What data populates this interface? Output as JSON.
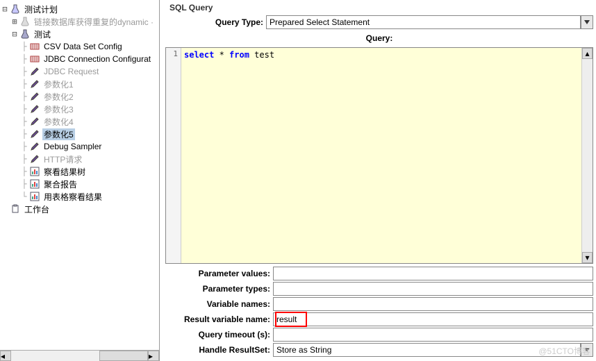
{
  "tree": {
    "root": "测试计划",
    "link_item": "链接数据库获得重复的dynamic ·",
    "test": "测试",
    "items": [
      {
        "label": "CSV Data Set Config",
        "icon": "csv",
        "dim": false
      },
      {
        "label": "JDBC Connection Configurat",
        "icon": "csv",
        "dim": false
      },
      {
        "label": "JDBC Request",
        "icon": "pen",
        "dim": true
      },
      {
        "label": "参数化1",
        "icon": "pen",
        "dim": true
      },
      {
        "label": "参数化2",
        "icon": "pen",
        "dim": true
      },
      {
        "label": "参数化3",
        "icon": "pen",
        "dim": true
      },
      {
        "label": "参数化4",
        "icon": "pen",
        "dim": true
      },
      {
        "label": "参数化5",
        "icon": "pen",
        "dim": false,
        "selected": true
      },
      {
        "label": "Debug Sampler",
        "icon": "pen",
        "dim": false
      },
      {
        "label": "HTTP请求",
        "icon": "pen",
        "dim": true
      },
      {
        "label": "察看结果树",
        "icon": "chart",
        "dim": false
      },
      {
        "label": "聚合报告",
        "icon": "chart",
        "dim": false
      },
      {
        "label": "用表格察看结果",
        "icon": "chart",
        "dim": false
      }
    ],
    "workbench": "工作台"
  },
  "panel": {
    "title": "SQL Query",
    "query_type_label": "Query Type:",
    "query_type_value": "Prepared Select Statement",
    "query_label": "Query:",
    "code": {
      "line": "1",
      "keywords": [
        "select",
        "from"
      ],
      "rest": [
        " * ",
        " test"
      ]
    },
    "fields": {
      "param_values": {
        "label": "Parameter values:",
        "value": ""
      },
      "param_types": {
        "label": "Parameter types:",
        "value": ""
      },
      "var_names": {
        "label": "Variable names:",
        "value": ""
      },
      "result_var": {
        "label": "Result variable name:",
        "value": "result"
      },
      "query_timeout": {
        "label": "Query timeout (s):",
        "value": ""
      },
      "handle_rs": {
        "label": "Handle ResultSet:",
        "value": "Store as String"
      }
    }
  },
  "watermark": "@51CTO博客",
  "icons": {
    "flask": "flask-icon",
    "pen": "pen-icon",
    "csv": "csv-icon",
    "chart": "chart-icon",
    "clipboard": "clipboard-icon"
  }
}
